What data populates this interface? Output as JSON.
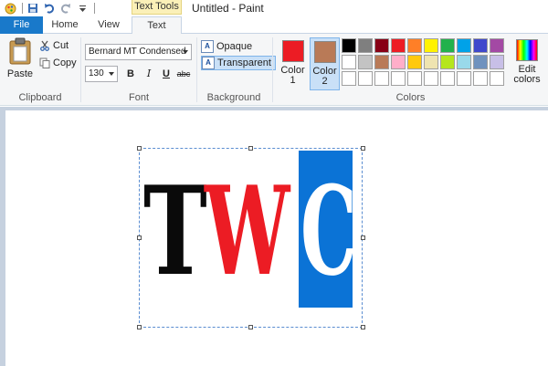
{
  "window": {
    "title": "Untitled - Paint",
    "context_tab_group": "Text Tools"
  },
  "tabs": {
    "file": "File",
    "home": "Home",
    "view": "View",
    "text": "Text"
  },
  "clipboard": {
    "paste": "Paste",
    "cut": "Cut",
    "copy": "Copy",
    "group_label": "Clipboard"
  },
  "font": {
    "family": "Bernard MT Condensed",
    "size": "130",
    "bold": "B",
    "italic": "I",
    "underline": "U",
    "strikethrough": "abc",
    "group_label": "Font"
  },
  "background": {
    "opaque": "Opaque",
    "transparent": "Transparent",
    "selected": "Transparent",
    "group_label": "Background"
  },
  "colors": {
    "color1_label": "Color",
    "color1_num": "1",
    "color1_value": "#ec1c24",
    "color2_label": "Color",
    "color2_num": "2",
    "color2_value": "#b97a57",
    "edit_label_1": "Edit",
    "edit_label_2": "colors",
    "group_label": "Colors",
    "palette_row1": [
      "#000000",
      "#7f7f7f",
      "#880015",
      "#ed1c24",
      "#ff7f27",
      "#fff200",
      "#22b14c",
      "#00a2e8",
      "#3f48cc",
      "#a349a4"
    ],
    "palette_row2": [
      "#ffffff",
      "#c3c3c3",
      "#b97a57",
      "#ffaec9",
      "#ffc90e",
      "#efe4b0",
      "#b5e61d",
      "#99d9ea",
      "#7092be",
      "#c8bfe7"
    ],
    "palette_row3": [
      "#ffffff",
      "#ffffff",
      "#ffffff",
      "#ffffff",
      "#ffffff",
      "#ffffff",
      "#ffffff",
      "#ffffff",
      "#ffffff",
      "#ffffff"
    ]
  },
  "canvas_text": {
    "letter1": "T",
    "letter1_color": "#0a0a0a",
    "letter2": "W",
    "letter2_color": "#ec1c24",
    "letter3": "C",
    "letter3_color": "#ffffff",
    "letter3_bg": "#0b73d6"
  }
}
